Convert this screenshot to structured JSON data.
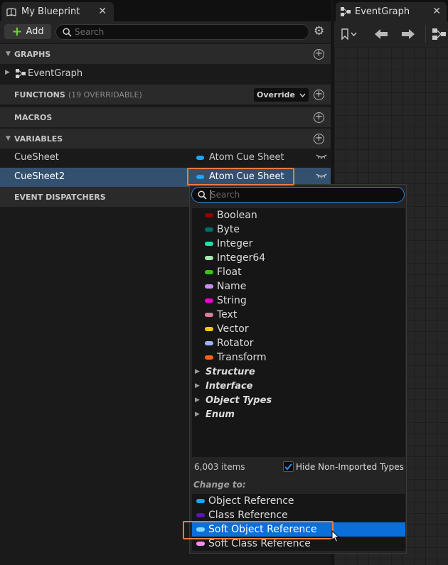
{
  "blueprint_tab": {
    "title": "My Blueprint",
    "close": "✕"
  },
  "toolbar": {
    "add_label": "Add",
    "search_placeholder": "Search"
  },
  "sections": {
    "graphs": "GRAPHS",
    "event_graph": "EventGraph",
    "functions": "FUNCTIONS",
    "functions_sub": "(19 OVERRIDABLE)",
    "override_label": "Override",
    "macros": "MACROS",
    "variables": "VARIABLES",
    "event_dispatchers": "EVENT DISPATCHERS"
  },
  "variables": [
    {
      "name": "CueSheet",
      "type": "Atom Cue Sheet"
    },
    {
      "name": "CueSheet2",
      "type": "Atom Cue Sheet"
    }
  ],
  "graph_tab": {
    "title": "EventGraph",
    "close": "✕"
  },
  "popup": {
    "search_placeholder": "Search",
    "types": [
      {
        "label": "Boolean",
        "color": "#950000"
      },
      {
        "label": "Byte",
        "color": "#006d65"
      },
      {
        "label": "Integer",
        "color": "#1fe0ab"
      },
      {
        "label": "Integer64",
        "color": "#a8e4b0"
      },
      {
        "label": "Float",
        "color": "#39c31e"
      },
      {
        "label": "Name",
        "color": "#c88ff0"
      },
      {
        "label": "String",
        "color": "#f000d8"
      },
      {
        "label": "Text",
        "color": "#e1799f"
      },
      {
        "label": "Vector",
        "color": "#f7c51d"
      },
      {
        "label": "Rotator",
        "color": "#9db2f7"
      },
      {
        "label": "Transform",
        "color": "#f06410"
      }
    ],
    "categories": [
      "Structure",
      "Interface",
      "Object Types",
      "Enum"
    ],
    "item_count": "6,003 items",
    "hide_label": "Hide Non-Imported Types",
    "hide_checked": true,
    "change_to": "Change to:",
    "references": [
      {
        "label": "Object Reference",
        "color": "#1aa6f7"
      },
      {
        "label": "Class Reference",
        "color": "#5f12b8"
      },
      {
        "label": "Soft Object Reference",
        "color": "#7ed8ff",
        "selected": true
      },
      {
        "label": "Soft Class Reference",
        "color": "#f58fe8"
      }
    ]
  },
  "colors": {
    "accent_orange": "#ee7a43",
    "selection_blue": "#0a6fd8",
    "cue_sheet_pill": "#1aa6f7"
  }
}
